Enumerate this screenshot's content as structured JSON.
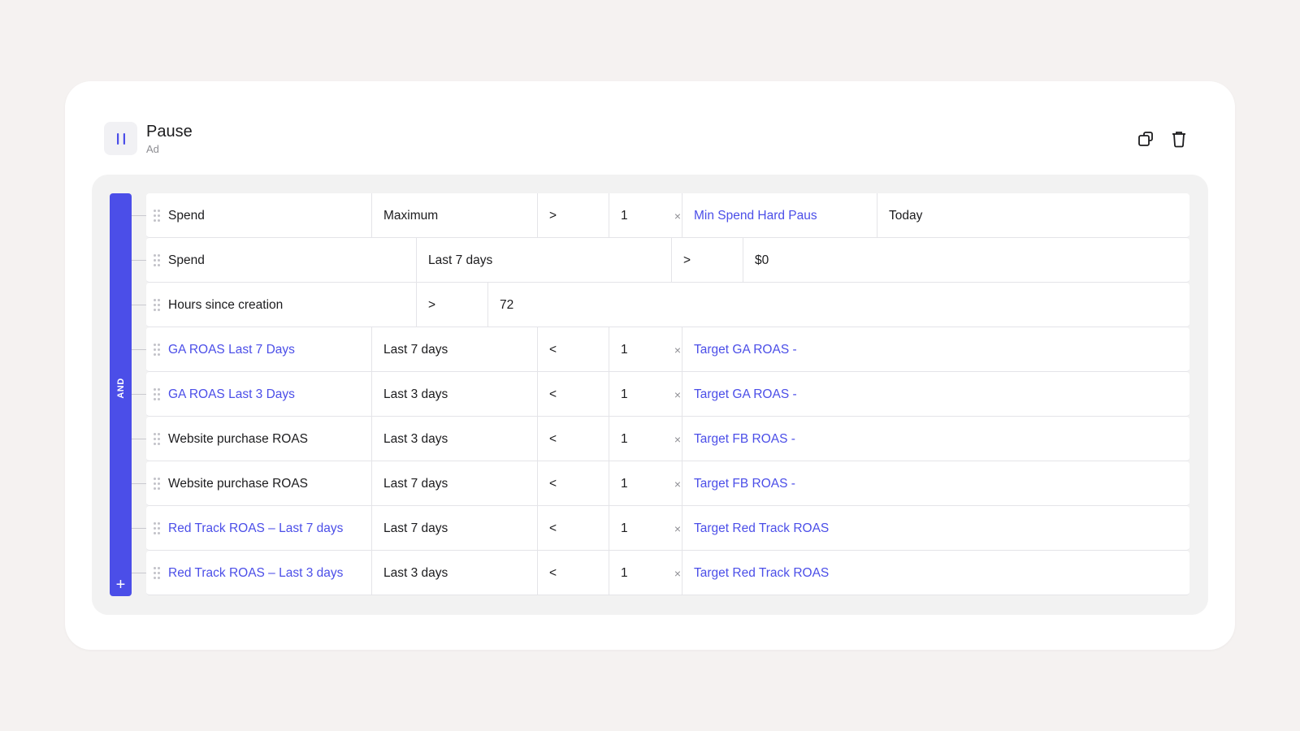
{
  "header": {
    "title": "Pause",
    "subtitle": "Ad",
    "icons": {
      "action": "pause-icon",
      "copy": "copy-icon",
      "delete": "trash-icon"
    }
  },
  "group": {
    "operator": "AND",
    "add_label": "+",
    "accent": "#4b4ee8"
  },
  "rows": [
    {
      "metric": "Spend",
      "metric_link": false,
      "window": "Maximum",
      "op": ">",
      "value": "1",
      "target": "Min Spend Hard Paus",
      "target_link": true,
      "extra": "Today"
    },
    {
      "metric": "Spend",
      "metric_link": false,
      "window": "Last 7 days",
      "op": ">",
      "value": "$0"
    },
    {
      "metric": "Hours since creation",
      "metric_link": false,
      "op": ">",
      "value": "72"
    },
    {
      "metric": "GA ROAS Last 7 Days",
      "metric_link": true,
      "window": "Last 7 days",
      "op": "<",
      "value": "1",
      "target": "Target GA ROAS -",
      "target_link": true
    },
    {
      "metric": "GA ROAS Last 3 Days",
      "metric_link": true,
      "window": "Last 3 days",
      "op": "<",
      "value": "1",
      "target": "Target GA ROAS -",
      "target_link": true
    },
    {
      "metric": "Website purchase ROAS",
      "metric_link": false,
      "window": "Last 3 days",
      "op": "<",
      "value": "1",
      "target": "Target FB ROAS -",
      "target_link": true
    },
    {
      "metric": "Website purchase ROAS",
      "metric_link": false,
      "window": "Last 7 days",
      "op": "<",
      "value": "1",
      "target": "Target FB ROAS -",
      "target_link": true
    },
    {
      "metric": "Red Track ROAS – Last 7 days",
      "metric_link": true,
      "window": "Last 7 days",
      "op": "<",
      "value": "1",
      "target": "Target Red Track ROAS",
      "target_link": true
    },
    {
      "metric": "Red Track ROAS – Last 3 days",
      "metric_link": true,
      "window": "Last 3 days",
      "op": "<",
      "value": "1",
      "target": "Target Red Track ROAS",
      "target_link": true
    }
  ]
}
